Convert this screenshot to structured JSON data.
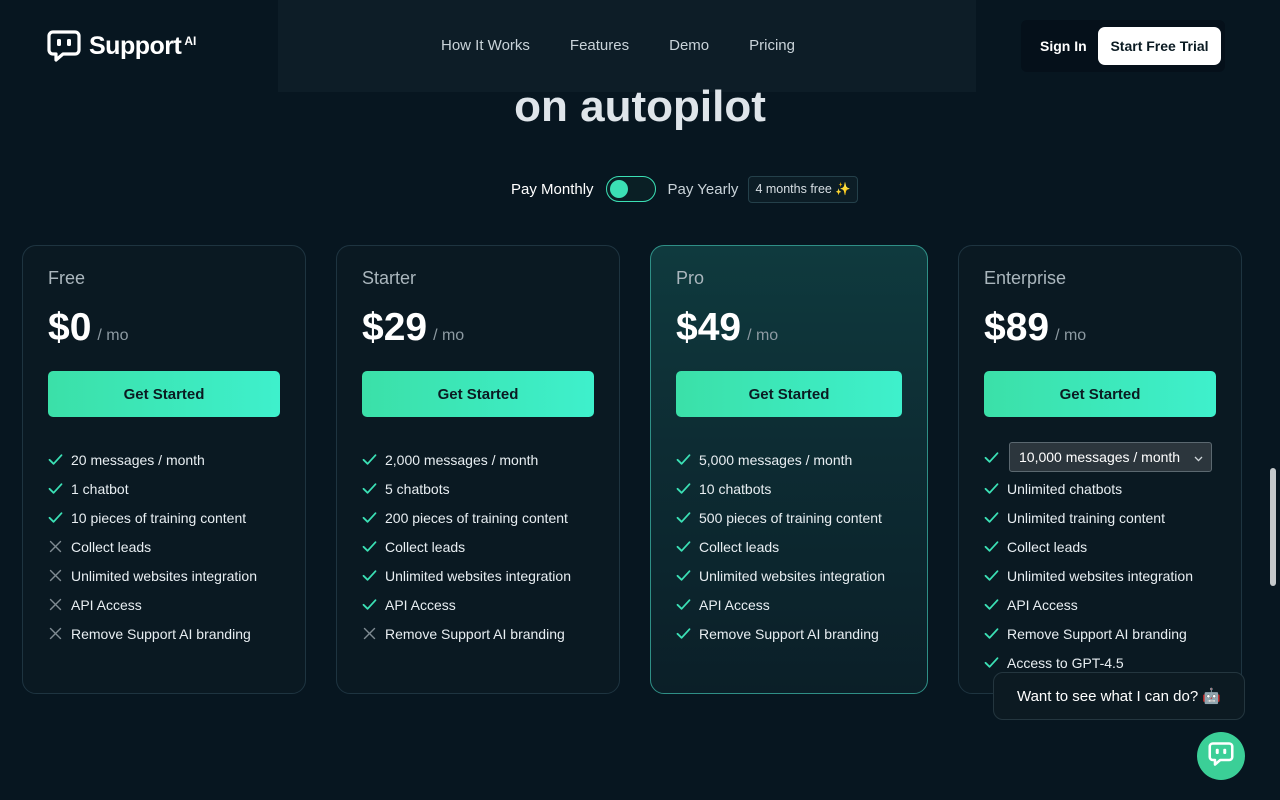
{
  "brand": {
    "name": "Support",
    "suffix": "AI"
  },
  "nav": {
    "links": [
      "How It Works",
      "Features",
      "Demo",
      "Pricing"
    ]
  },
  "auth": {
    "signin": "Sign In",
    "trial": "Start Free Trial"
  },
  "hero": {
    "line": "on autopilot"
  },
  "billing": {
    "monthly": "Pay Monthly",
    "yearly": "Pay Yearly",
    "badge": "4 months free ✨",
    "yearly_selected": false
  },
  "plans": [
    {
      "name": "Free",
      "price": "$0",
      "per": "/ mo",
      "cta": "Get Started",
      "features": [
        {
          "text": "20 messages / month",
          "included": true
        },
        {
          "text": "1 chatbot",
          "included": true
        },
        {
          "text": "10 pieces of training content",
          "included": true
        },
        {
          "text": "Collect leads",
          "included": false
        },
        {
          "text": "Unlimited websites integration",
          "included": false
        },
        {
          "text": "API Access",
          "included": false
        },
        {
          "text": "Remove Support AI branding",
          "included": false
        }
      ]
    },
    {
      "name": "Starter",
      "price": "$29",
      "per": "/ mo",
      "cta": "Get Started",
      "features": [
        {
          "text": "2,000 messages / month",
          "included": true
        },
        {
          "text": "5 chatbots",
          "included": true
        },
        {
          "text": "200 pieces of training content",
          "included": true
        },
        {
          "text": "Collect leads",
          "included": true
        },
        {
          "text": "Unlimited websites integration",
          "included": true
        },
        {
          "text": "API Access",
          "included": true
        },
        {
          "text": "Remove Support AI branding",
          "included": false
        }
      ]
    },
    {
      "name": "Pro",
      "price": "$49",
      "per": "/ mo",
      "cta": "Get Started",
      "features": [
        {
          "text": "5,000 messages / month",
          "included": true
        },
        {
          "text": "10 chatbots",
          "included": true
        },
        {
          "text": "500 pieces of training content",
          "included": true
        },
        {
          "text": "Collect leads",
          "included": true
        },
        {
          "text": "Unlimited websites integration",
          "included": true
        },
        {
          "text": "API Access",
          "included": true
        },
        {
          "text": "Remove Support AI branding",
          "included": true
        }
      ]
    },
    {
      "name": "Enterprise",
      "price": "$89",
      "per": "/ mo",
      "cta": "Get Started",
      "message_select": "10,000 messages / month",
      "features": [
        {
          "text": "Unlimited chatbots",
          "included": true
        },
        {
          "text": "Unlimited training content",
          "included": true
        },
        {
          "text": "Collect leads",
          "included": true
        },
        {
          "text": "Unlimited websites integration",
          "included": true
        },
        {
          "text": "API Access",
          "included": true
        },
        {
          "text": "Remove Support AI branding",
          "included": true
        },
        {
          "text": "Access to GPT-4.5",
          "included": true
        }
      ]
    }
  ],
  "chat": {
    "prompt": "Want to see what I can do? 🤖"
  },
  "colors": {
    "accent": "#3be0b5",
    "background": "#071620",
    "card": "#0a1922"
  }
}
